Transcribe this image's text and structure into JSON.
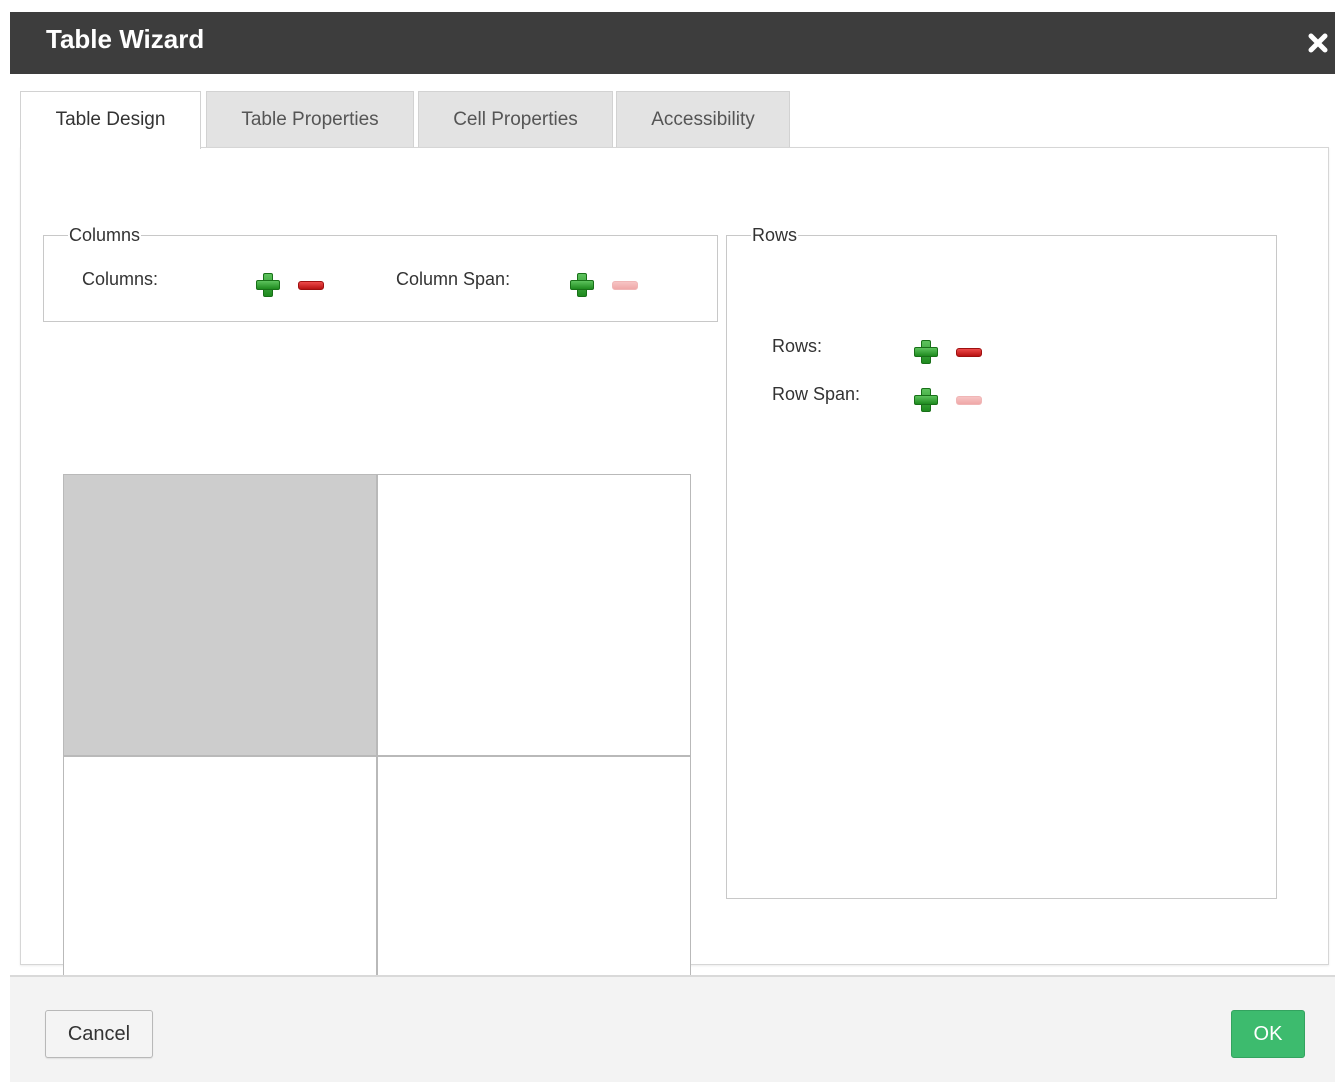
{
  "window": {
    "title": "Table Wizard",
    "close_icon": "close-icon"
  },
  "tabs": [
    {
      "label": "Table Design",
      "active": true
    },
    {
      "label": "Table Properties",
      "active": false
    },
    {
      "label": "Cell Properties",
      "active": false
    },
    {
      "label": "Accessibility",
      "active": false
    }
  ],
  "columns_group": {
    "legend": "Columns",
    "columns_label": "Columns:",
    "column_span_label": "Column Span:",
    "column_span_remove_enabled": false
  },
  "rows_group": {
    "legend": "Rows",
    "rows_label": "Rows:",
    "row_span_label": "Row Span:",
    "row_span_remove_enabled": false
  },
  "table_grid": {
    "rows": 2,
    "columns": 2,
    "selected_cell": [
      0,
      0
    ],
    "selected_color": "#cdcdcd"
  },
  "footer": {
    "cancel_label": "Cancel",
    "ok_label": "OK"
  },
  "colors": {
    "titlebar": "#3d3d3d",
    "ok_button": "#3dbb6e",
    "plus_icon": "#2e9e2e",
    "minus_icon": "#d42020",
    "minus_icon_disabled": "#f3b5b5"
  }
}
